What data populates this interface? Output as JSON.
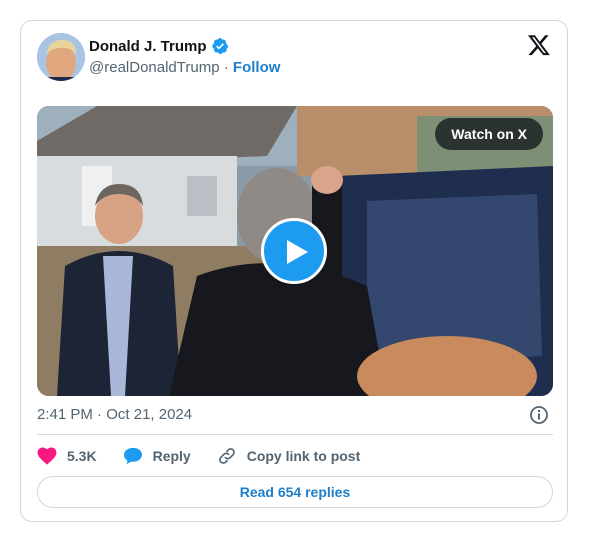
{
  "author": {
    "display_name": "Donald J. Trump",
    "handle": "@realDonaldTrump",
    "separator": "·",
    "follow_label": "Follow",
    "verified_icon": "verified-badge-icon",
    "avatar_icon": "avatar"
  },
  "media": {
    "watch_label": "Watch on X",
    "play_icon": "play-icon"
  },
  "meta": {
    "time": "2:41 PM",
    "separator": "·",
    "date": "Oct 21, 2024",
    "info_icon": "info-icon"
  },
  "actions": {
    "like_count": "5.3K",
    "reply_label": "Reply",
    "copy_label": "Copy link to post",
    "like_icon": "heart-icon",
    "reply_icon": "speech-bubble-icon",
    "copy_icon": "link-icon"
  },
  "footer": {
    "replies_label": "Read 654 replies"
  },
  "colors": {
    "accent": "#1d9bf0",
    "link": "#1d7ecb",
    "like": "#f91880",
    "text_primary": "#0f1419",
    "text_secondary": "#536471",
    "border": "#cfd9de"
  }
}
